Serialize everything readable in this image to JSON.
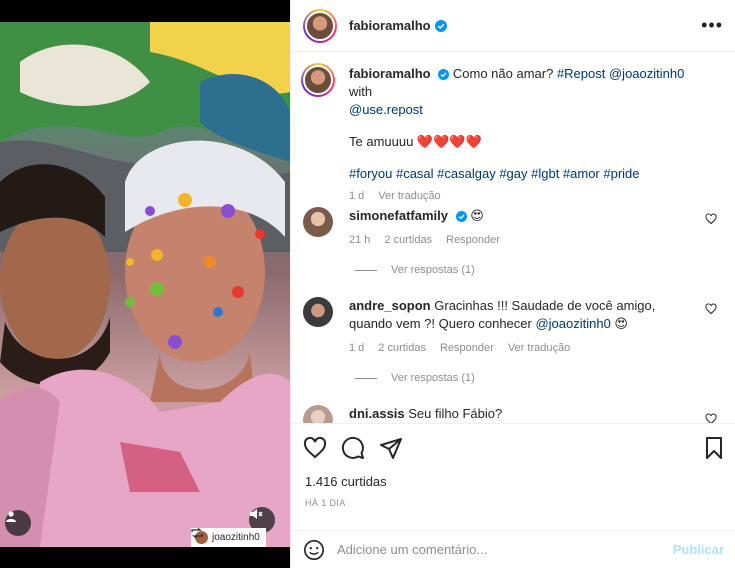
{
  "post": {
    "author": "fabioramalho",
    "caption_text": "Como não amar? #Repost @joaozitinh0 with @use.repost",
    "caption_line1_pre": "Como não amar? ",
    "caption_hash1": "#Repost",
    "caption_mention": "@joaozitinh0",
    "caption_with": " with",
    "caption_line2": "@use.repost",
    "caption_line3": "Te amuuuu ❤️❤️❤️❤️",
    "hashtags": "#foryou #casal #casalgay #gay #lgbt #amor #pride",
    "caption_time": "1 d",
    "see_translation": "Ver tradução",
    "likes": "1.416 curtidas",
    "date": "HÁ 1 DIA",
    "media_tag": "joaozitinh0"
  },
  "comments": [
    {
      "user": "simonefatfamily",
      "text": "😍",
      "time": "21 h",
      "likes": "2 curtidas",
      "reply_label": "Responder",
      "view_replies": "Ver respostas (1)"
    },
    {
      "user": "andre_sopon",
      "text": "Gracinhas !!! Saudade de você amigo,",
      "text_line2_pre": "quando vem ?! Quero conhecer ",
      "text_mention": "@joaozitinh0",
      "text_emoji": " 😍",
      "time": "1 d",
      "likes": "2 curtidas",
      "reply_label": "Responder",
      "translate": "Ver tradução",
      "view_replies": "Ver respostas (1)"
    },
    {
      "user": "dni.assis",
      "text": "Seu filho Fábio?"
    }
  ],
  "composer": {
    "placeholder": "Adicione um comentário...",
    "publish": "Publicar"
  },
  "icons": {
    "like": "heart-icon",
    "comment": "comment-icon",
    "share": "share-icon",
    "save": "bookmark-icon",
    "emoji": "emoji-icon",
    "more": "more-icon"
  },
  "colors": {
    "link": "#00376b",
    "verified": "#0095f6",
    "publish_disabled": "#b2dffc"
  }
}
